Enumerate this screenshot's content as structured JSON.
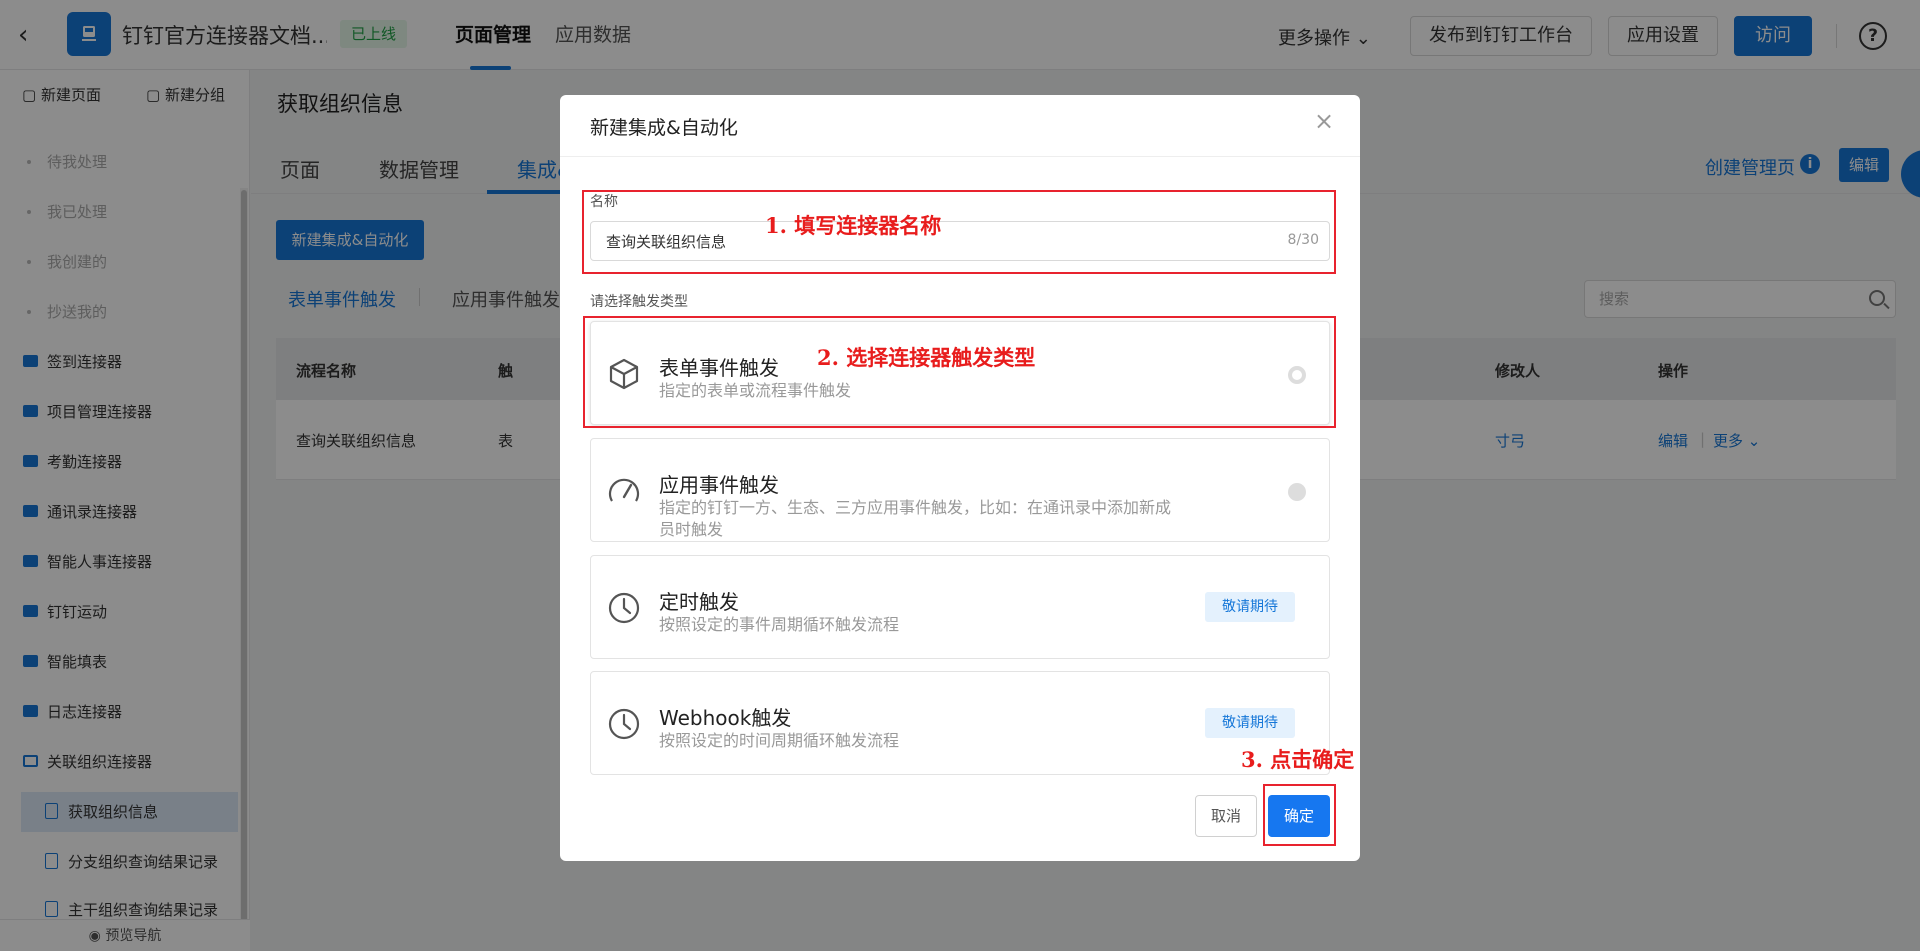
{
  "topbar": {
    "back_icon": "chevron-left-icon",
    "app_name": "钉钉官方连接器文档...",
    "status_badge": "已上线",
    "tabs": [
      {
        "label": "页面管理"
      },
      {
        "label": "应用数据"
      }
    ],
    "more_actions": "更多操作",
    "publish": "发布到钉钉工作台",
    "app_settings": "应用设置",
    "visit": "访问",
    "help": "?"
  },
  "sidebar": {
    "new_page": "新建页面",
    "new_group": "新建分组",
    "items": [
      {
        "label": "待我处理"
      },
      {
        "label": "我已处理"
      },
      {
        "label": "我创建的"
      },
      {
        "label": "抄送我的"
      },
      {
        "label": "签到连接器"
      },
      {
        "label": "项目管理连接器"
      },
      {
        "label": "考勤连接器"
      },
      {
        "label": "通讯录连接器"
      },
      {
        "label": "智能人事连接器"
      },
      {
        "label": "钉钉运动"
      },
      {
        "label": "智能填表"
      },
      {
        "label": "日志连接器"
      },
      {
        "label": "关联组织连接器"
      },
      {
        "label": "获取组织信息"
      },
      {
        "label": "分支组织查询结果记录"
      },
      {
        "label": "主干组织查询结果记录"
      }
    ],
    "preview_nav": "预览导航"
  },
  "main": {
    "page_title": "获取组织信息",
    "tabs": [
      {
        "label": "页面"
      },
      {
        "label": "数据管理"
      },
      {
        "label": "集成&自动化"
      }
    ],
    "create_admin_page": "创建管理页",
    "edit": "编辑",
    "new_integration_btn": "新建集成&自动化",
    "sub_tabs": [
      {
        "label": "表单事件触发"
      },
      {
        "label": "应用事件触发"
      }
    ],
    "search_placeholder": "搜索",
    "table": {
      "headers": [
        "流程名称",
        "触",
        "修改人",
        "操作"
      ],
      "rows": [
        {
          "name": "查询关联组织信息",
          "trigger": "表",
          "modifier": "寸弓",
          "edit": "编辑",
          "more": "更多"
        }
      ]
    }
  },
  "modal": {
    "title": "新建集成&自动化",
    "name_label": "名称",
    "name_value": "查询关联组织信息",
    "name_counter": "8/30",
    "trigger_label": "请选择触发类型",
    "options": [
      {
        "title": "表单事件触发",
        "desc": "指定的表单或流程事件触发",
        "icon": "cube-icon",
        "state": "selected"
      },
      {
        "title": "应用事件触发",
        "desc": "指定的钉钉一方、生态、三方应用事件触发，比如：在通讯录中添加新成员时触发",
        "icon": "speedometer-icon",
        "state": "available"
      },
      {
        "title": "定时触发",
        "desc": "按照设定的事件周期循环触发流程",
        "icon": "clock-icon",
        "badge": "敬请期待"
      },
      {
        "title": "Webhook触发",
        "desc": "按照设定的时间周期循环触发流程",
        "icon": "clock-icon",
        "badge": "敬请期待"
      }
    ],
    "cancel": "取消",
    "confirm": "确定"
  },
  "annotations": {
    "step1": "1. 填写连接器名称",
    "step2": "2. 选择连接器触发类型",
    "step3": "3. 点击确定",
    "color": "#e8232e"
  },
  "colors": {
    "primary": "#1677d8",
    "success": "#22a046",
    "overlay": "rgba(0,0,0,0.45)"
  }
}
